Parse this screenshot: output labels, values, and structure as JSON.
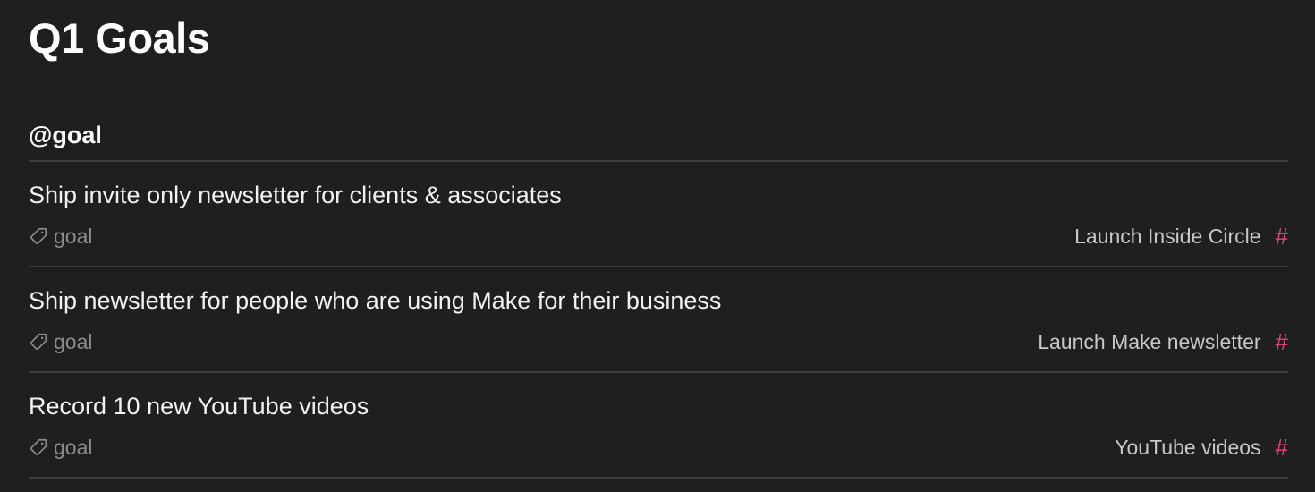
{
  "page": {
    "title": "Q1 Goals"
  },
  "group": {
    "header": "@goal"
  },
  "items": [
    {
      "title": "Ship invite only newsletter for clients & associates",
      "tag": "goal",
      "link": "Launch Inside Circle",
      "link_icon": "#"
    },
    {
      "title": "Ship newsletter for people who are using Make for their business",
      "tag": "goal",
      "link": "Launch Make newsletter",
      "link_icon": "#"
    },
    {
      "title": "Record 10 new YouTube videos",
      "tag": "goal",
      "link": "YouTube videos",
      "link_icon": "#"
    }
  ],
  "colors": {
    "background": "#1f1f1f",
    "hash_accent": "#e0457b",
    "divider": "#3d3d3d",
    "muted_text": "#8c8c8c"
  },
  "icons": {
    "tag": "tag-icon",
    "hash": "hash-icon"
  }
}
